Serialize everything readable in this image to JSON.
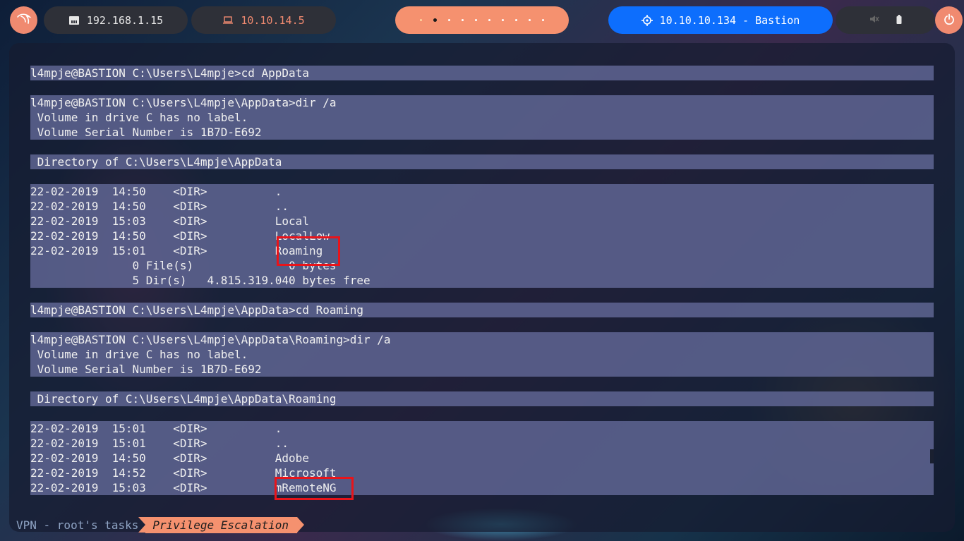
{
  "topbar": {
    "host_ip": "192.168.1.15",
    "vpn_ip": "10.10.14.5",
    "target": "10.10.10.134 - Bastion",
    "icons": [
      "kali-dragon-icon",
      "host-ethernet-icon",
      "laptop-icon",
      "workspace-dots",
      "crosshair-icon",
      "mute-icon",
      "battery-icon",
      "power-icon"
    ]
  },
  "terminal": {
    "lines": [
      "l4mpje@BASTION C:\\Users\\L4mpje>cd AppData",
      "",
      "l4mpje@BASTION C:\\Users\\L4mpje\\AppData>dir /a",
      " Volume in drive C has no label.",
      " Volume Serial Number is 1B7D-E692",
      "",
      " Directory of C:\\Users\\L4mpje\\AppData",
      "",
      "22-02-2019  14:50    <DIR>          .",
      "22-02-2019  14:50    <DIR>          ..",
      "22-02-2019  15:03    <DIR>          Local",
      "22-02-2019  14:50    <DIR>          LocalLow",
      "22-02-2019  15:01    <DIR>          Roaming",
      "               0 File(s)              0 bytes",
      "               5 Dir(s)   4.815.319.040 bytes free",
      "",
      "l4mpje@BASTION C:\\Users\\L4mpje\\AppData>cd Roaming",
      "",
      "l4mpje@BASTION C:\\Users\\L4mpje\\AppData\\Roaming>dir /a",
      " Volume in drive C has no label.",
      " Volume Serial Number is 1B7D-E692",
      "",
      " Directory of C:\\Users\\L4mpje\\AppData\\Roaming",
      "",
      "22-02-2019  15:01    <DIR>          .",
      "22-02-2019  15:01    <DIR>          ..",
      "22-02-2019  14:50    <DIR>          Adobe",
      "22-02-2019  14:52    <DIR>          Microsoft",
      "22-02-2019  15:03    <DIR>          mRemoteNG"
    ],
    "highlighted": [
      "Roaming",
      "mRemoteNG"
    ]
  },
  "statusline": {
    "session": "VPN - root's tasks",
    "window": "Privilege Escalation"
  },
  "colors": {
    "accent": "#f5916f",
    "target_pill": "#0d6efd",
    "highlight_box": "#e8141a",
    "line_bg": "#626896"
  }
}
